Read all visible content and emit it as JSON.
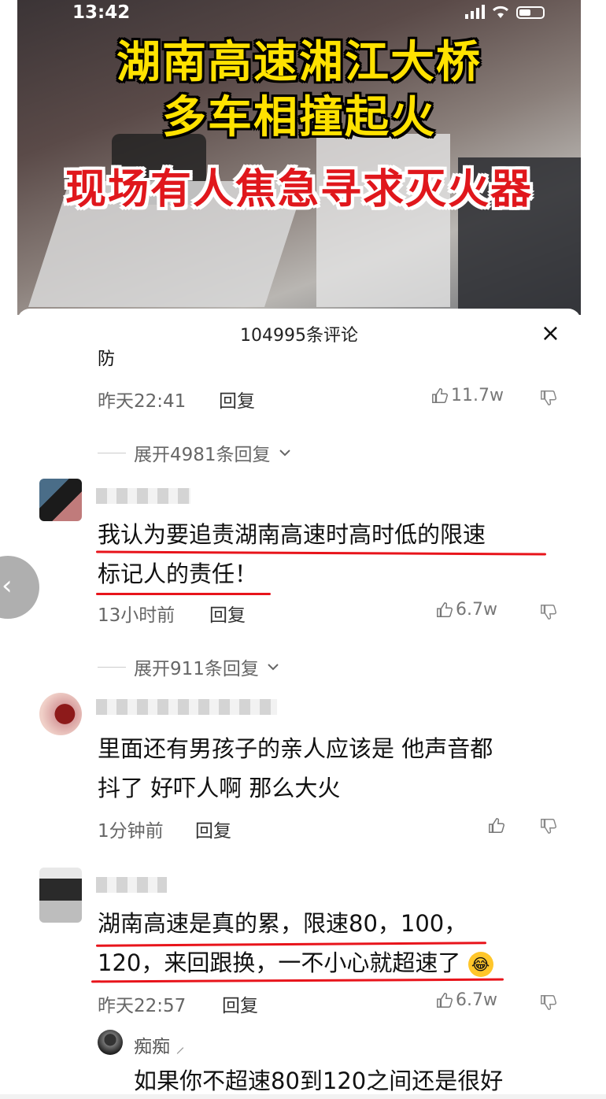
{
  "status_bar": {
    "time": "13:42"
  },
  "video": {
    "caption_line1": "湖南高速湘江大桥",
    "caption_line2": "多车相撞起火",
    "caption_line3": "现场有人焦急寻求灭火器"
  },
  "sheet": {
    "title": "104995条评论",
    "close_icon": "×"
  },
  "comments": [
    {
      "text_fragment": "防",
      "time": "昨天22:41",
      "reply": "回复",
      "likes": "11.7w",
      "expand": "展开4981条回复"
    },
    {
      "text": "我认为要追责湖南高速时高时低的限速标记人的责任！",
      "line1": "我认为要追责湖南高速时高时低的限速",
      "line2": "标记人的责任！",
      "time": "13小时前",
      "reply": "回复",
      "likes": "6.7w",
      "expand": "展开911条回复"
    },
    {
      "line1": "里面还有男孩子的亲人应该是 他声音都",
      "line2": "抖了 好吓人啊 那么大火",
      "time": "1分钟前",
      "reply": "回复",
      "likes": ""
    },
    {
      "line1": "湖南高速是真的累，限速80，100，",
      "line2": "120，来回跟换，一不小心就超速了",
      "time": "昨天22:57",
      "reply": "回复",
      "likes": "6.7w"
    }
  ],
  "sub_reply": {
    "username": "痴痴",
    "text": "如果你不超速80到120之间还是很好"
  },
  "icons": {
    "like": "thumbs-up-icon",
    "dislike": "thumbs-down-icon",
    "chevron": "chevron-down-icon",
    "back": "chevron-left-icon"
  }
}
